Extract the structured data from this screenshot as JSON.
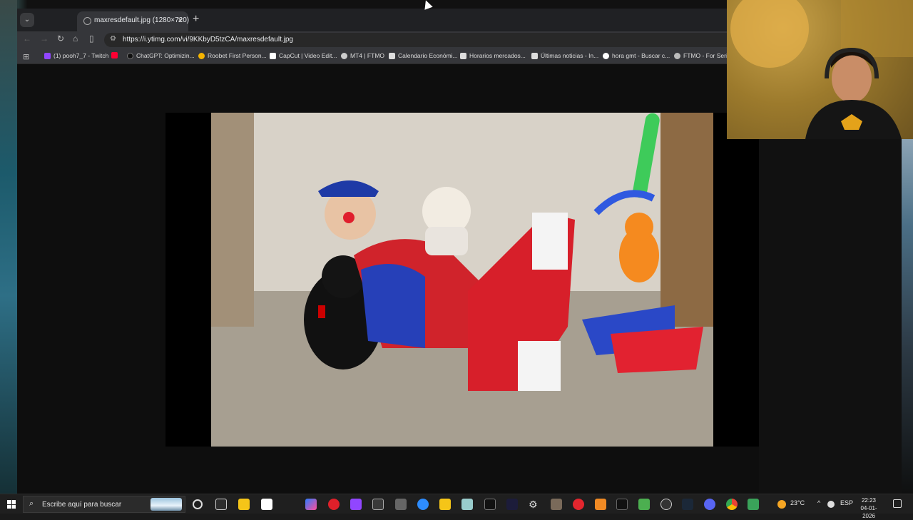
{
  "browser": {
    "tab_title": "maxresdefault.jpg (1280×720)",
    "url": "https://i.ytimg.com/vi/9KKbyD5tzCA/maxresdefault.jpg",
    "bookmarks": [
      {
        "label": "(1) pooh7_7 - Twitch",
        "color": "#9146ff"
      },
      {
        "label": "",
        "color": "#ff0033"
      },
      {
        "label": "ChatGPT: Optimizin...",
        "color": "#111111"
      },
      {
        "label": "Roobet First Person...",
        "color": "#f5b400"
      },
      {
        "label": "CapCut | Video Edit...",
        "color": "#ffffff"
      },
      {
        "label": "MT4 | FTMO",
        "color": "#cccccc"
      },
      {
        "label": "Calendario Económi...",
        "color": "#dddddd"
      },
      {
        "label": "Horarios mercados...",
        "color": "#dddddd"
      },
      {
        "label": "Últimas noticias - In...",
        "color": "#dddddd"
      },
      {
        "label": "hora gmt - Buscar c...",
        "color": "#ffffff"
      },
      {
        "label": "FTMO - For Seriou",
        "color": "#bbbbbb"
      }
    ]
  },
  "photo": {
    "description_icon": "clown-with-dogs-photo"
  },
  "taskbar": {
    "search_placeholder": "Escribe aquí para buscar",
    "weather": "23°C",
    "language": "ESP",
    "time": "22:23",
    "date": "04-01-2026"
  }
}
